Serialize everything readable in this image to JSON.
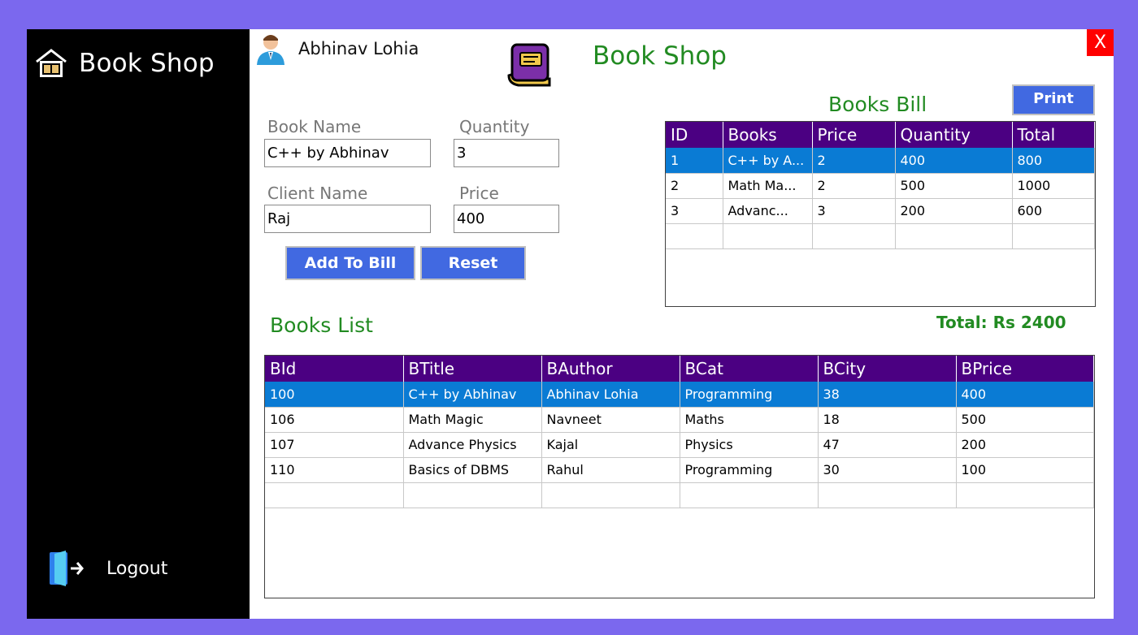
{
  "sidebar": {
    "title": "Book Shop",
    "logout_label": "Logout"
  },
  "header": {
    "user_name": "Abhinav Lohia",
    "app_title": "Book Shop",
    "close_label": "X"
  },
  "form": {
    "book_name_label": "Book Name",
    "book_name_value": "C++ by Abhinav",
    "quantity_label": "Quantity",
    "quantity_value": "3",
    "client_name_label": "Client Name",
    "client_name_value": "Raj",
    "price_label": "Price",
    "price_value": "400",
    "add_button": "Add To Bill",
    "reset_button": "Reset"
  },
  "bill": {
    "title": "Books Bill",
    "print_button": "Print",
    "columns": [
      "ID",
      "Books",
      "Price",
      "Quantity",
      "Total"
    ],
    "rows": [
      [
        "1",
        "C++ by A...",
        "2",
        "400",
        "800"
      ],
      [
        "2",
        "Math Ma...",
        "2",
        "500",
        "1000"
      ],
      [
        "3",
        "Advanc...",
        "3",
        "200",
        "600"
      ]
    ],
    "total_text": "Total: Rs 2400"
  },
  "books": {
    "title": "Books List",
    "columns": [
      "BId",
      "BTitle",
      "BAuthor",
      "BCat",
      "BCity",
      "BPrice"
    ],
    "rows": [
      [
        "100",
        "C++ by Abhinav",
        "Abhinav Lohia",
        "Programming",
        "38",
        "400"
      ],
      [
        "106",
        "Math Magic",
        "Navneet",
        "Maths",
        "18",
        "500"
      ],
      [
        "107",
        "Advance Physics",
        "Kajal",
        "Physics",
        "47",
        "200"
      ],
      [
        "110",
        "Basics of DBMS",
        "Rahul",
        "Programming",
        "30",
        "100"
      ]
    ]
  },
  "colors": {
    "frame": "#7b68ee",
    "sidebar": "#000000",
    "accent_green": "#228b22",
    "button_blue": "#4169e1",
    "header_purple": "#4b0082",
    "selection_blue": "#0a7bd4",
    "close_red": "#ff0000"
  },
  "icons": {
    "brand": "book-shop-icon",
    "user": "user-avatar-icon",
    "logo": "book-logo-icon",
    "logout": "logout-icon"
  }
}
